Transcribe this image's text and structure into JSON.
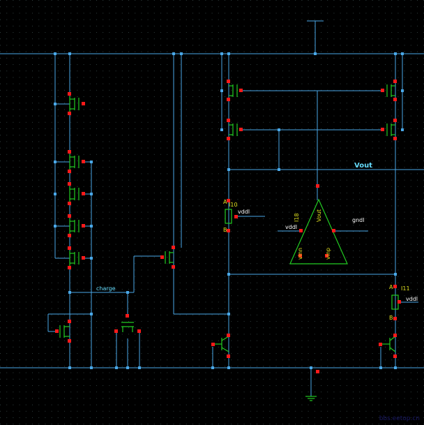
{
  "colors": {
    "background": "#000000",
    "grid_dot": "#2f3f3f",
    "wire": "#4aa8e8",
    "device": "#22cc22",
    "pin": "#ff1a1a",
    "resistor": "#22cc22",
    "text_yellow": "#e0e020",
    "text_cyan": "#66ddff"
  },
  "labels": {
    "vout": "Vout",
    "charge": "charge",
    "amp_ref": "I18",
    "amp_out_pin": "Vout",
    "amp_in_minus": "vinn",
    "amp_in_plus": "vinp",
    "amp_vdd": "vddl",
    "amp_gnd": "gndl",
    "r_left_ref": "I10",
    "r_left_vdd": "vddl",
    "r_left_a": "A",
    "r_left_b": "B",
    "r_right_ref": "I11",
    "r_right_vdd": "vddl",
    "r_right_a": "A",
    "r_right_b": "B"
  },
  "watermark": "bbs.eetop.cn"
}
